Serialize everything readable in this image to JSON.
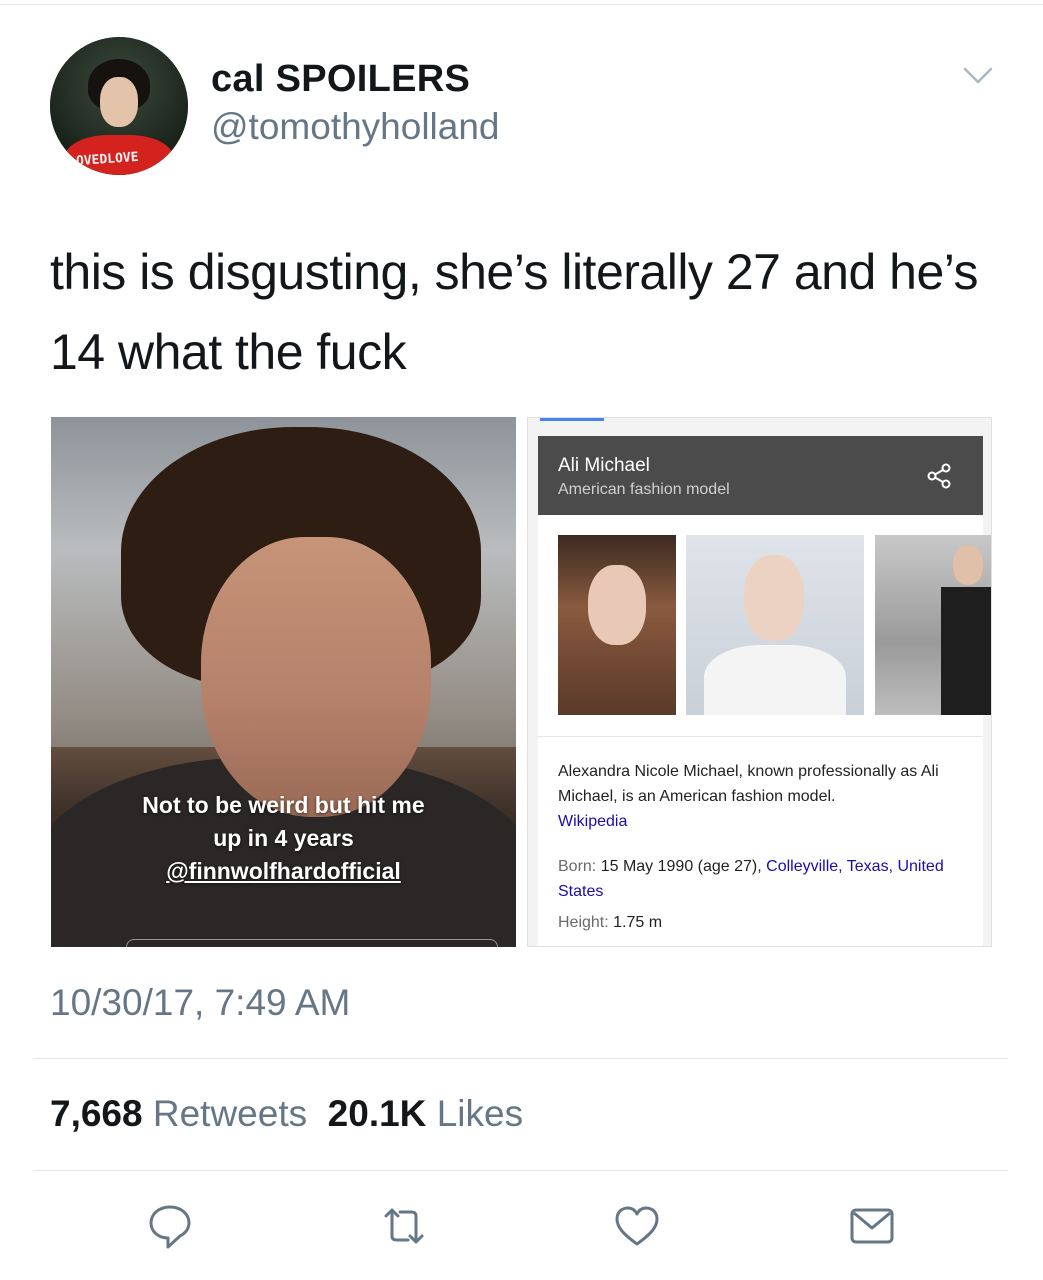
{
  "tweet": {
    "display_name": "cal SPOILERS",
    "handle": "@tomothyholland",
    "text": "this is disgusting, she’s literally 27 and he’s 14 what the fuck",
    "timestamp": "10/30/17, 7:49 AM"
  },
  "avatar": {
    "shirt_text": "OVEDLOVE"
  },
  "media_left": {
    "caption_line1": "Not to be weird but hit me",
    "caption_line2": "up in 4 years",
    "caption_line3": "@finnwolfhardofficial"
  },
  "knowledge_panel": {
    "title": "Ali Michael",
    "subtitle": "American fashion model",
    "description": "Alexandra Nicole Michael, known professionally as Ali Michael, is an American fashion model.",
    "source": "Wikipedia",
    "born_label": "Born:",
    "born_value": "15 May 1990 (age 27),",
    "born_place": "Colleyville, Texas, United States",
    "height_label": "Height:",
    "height_value": "1.75 m"
  },
  "stats": {
    "retweets_count": "7,668",
    "retweets_label": "Retweets",
    "likes_count": "20.1K",
    "likes_label": "Likes"
  },
  "icons": [
    "chevron-down-icon",
    "share-icon",
    "reply-icon",
    "retweet-icon",
    "like-icon",
    "message-icon"
  ],
  "colors": {
    "secondary_text": "#657786",
    "link": "#1a0dab",
    "divider": "#e1e8ed"
  }
}
